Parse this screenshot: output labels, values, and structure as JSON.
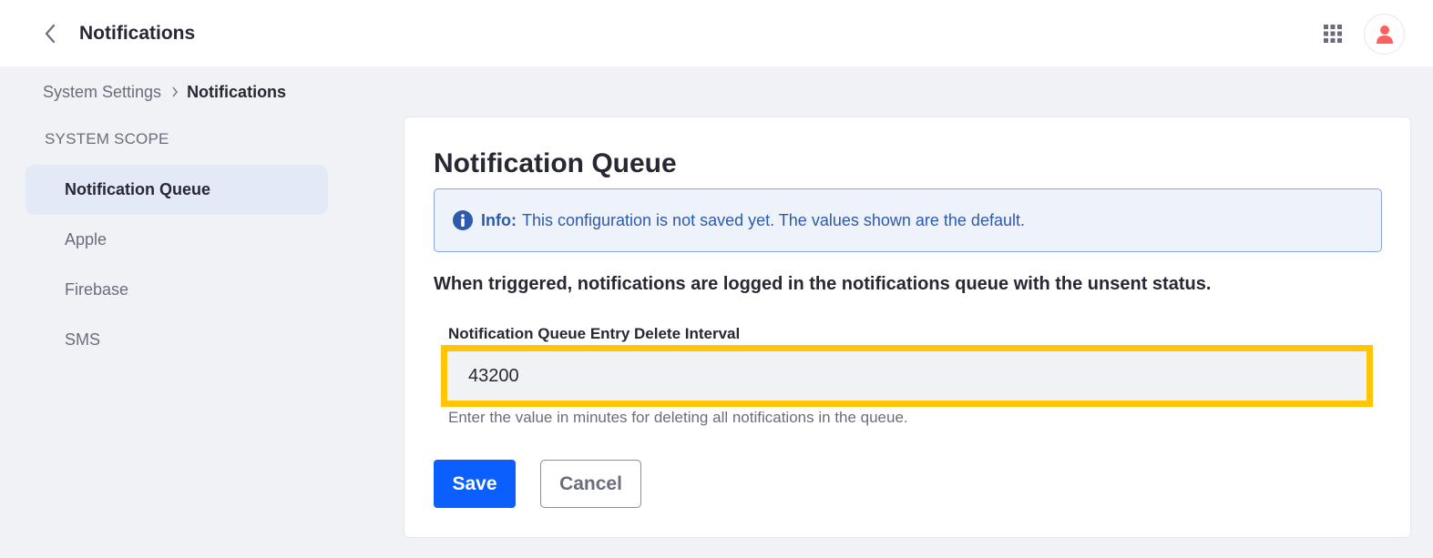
{
  "header": {
    "title": "Notifications",
    "back_icon": "chevron-left-icon",
    "apps_icon": "grid-icon",
    "avatar_icon": "user-icon",
    "avatar_color": "#ff5f5f"
  },
  "breadcrumb": {
    "items": [
      "System Settings",
      "Notifications"
    ],
    "separator_icon": "chevron-right-icon"
  },
  "sidebar": {
    "heading": "SYSTEM SCOPE",
    "items": [
      {
        "label": "Notification Queue",
        "active": true
      },
      {
        "label": "Apple",
        "active": false
      },
      {
        "label": "Firebase",
        "active": false
      },
      {
        "label": "SMS",
        "active": false
      }
    ]
  },
  "main": {
    "title": "Notification Queue",
    "alert": {
      "icon": "info-circle-icon",
      "label": "Info:",
      "message": "This configuration is not saved yet. The values shown are the default."
    },
    "description": "When triggered, notifications are logged in the notifications queue with the unsent status.",
    "field": {
      "label": "Notification Queue Entry Delete Interval",
      "value": "43200",
      "help": "Enter the value in minutes for deleting all notifications in the queue.",
      "highlight_color": "#ffc506"
    },
    "buttons": {
      "save": "Save",
      "cancel": "Cancel"
    }
  },
  "colors": {
    "primary": "#0b5fff",
    "info": "#2e5aac",
    "background": "#f1f2f5"
  }
}
